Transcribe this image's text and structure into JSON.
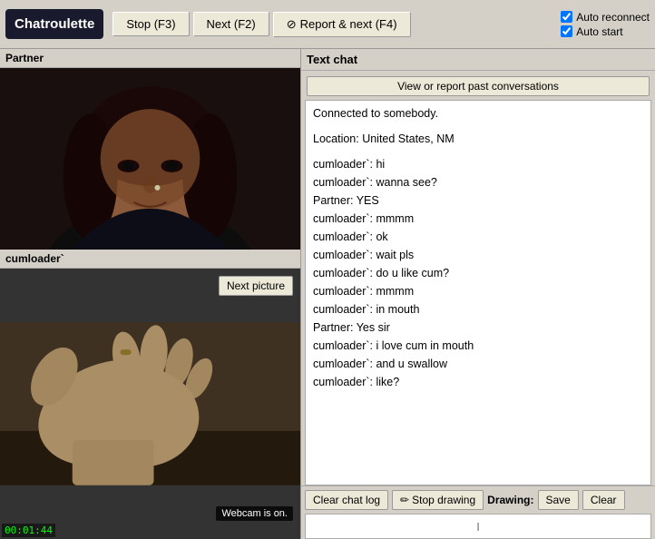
{
  "toolbar": {
    "logo": "Chatroulette",
    "stop_btn": "Stop (F3)",
    "next_btn": "Next (F2)",
    "report_btn": "Report & next (F4)",
    "auto_reconnect_label": "Auto reconnect",
    "auto_start_label": "Auto start",
    "auto_reconnect_checked": true,
    "auto_start_checked": true
  },
  "left_panel": {
    "partner_label": "Partner",
    "self_label": "cumloader`",
    "next_picture_btn": "Next picture",
    "webcam_badge": "Webcam is on.",
    "timer": "00:01:44"
  },
  "right_panel": {
    "header": "Text chat",
    "view_report_btn": "View or report past conversations",
    "messages": [
      {
        "text": "Connected to somebody.",
        "type": "system"
      },
      {
        "text": "",
        "type": "blank"
      },
      {
        "text": "Location: United States, NM",
        "type": "system"
      },
      {
        "text": "",
        "type": "blank"
      },
      {
        "text": "cumloader`: hi",
        "type": "chat"
      },
      {
        "text": "cumloader`: wanna see?",
        "type": "chat"
      },
      {
        "text": "Partner: YES",
        "type": "chat"
      },
      {
        "text": "cumloader`: mmmm",
        "type": "chat"
      },
      {
        "text": "cumloader`: ok",
        "type": "chat"
      },
      {
        "text": "cumloader`: wait pls",
        "type": "chat"
      },
      {
        "text": "cumloader`: do u like cum?",
        "type": "chat"
      },
      {
        "text": "cumloader`: mmmm",
        "type": "chat"
      },
      {
        "text": "cumloader`: in mouth",
        "type": "chat"
      },
      {
        "text": "Partner: Yes sir",
        "type": "chat"
      },
      {
        "text": "cumloader`: i love cum in mouth",
        "type": "chat"
      },
      {
        "text": "cumloader`: and u swallow",
        "type": "chat"
      },
      {
        "text": "cumloader`: like?",
        "type": "chat"
      }
    ]
  },
  "bottom_bar": {
    "clear_chat_btn": "Clear chat log",
    "stop_drawing_btn": "Stop drawing",
    "drawing_label": "Drawing:",
    "save_btn": "Save",
    "clear_btn": "Clear"
  },
  "chat_input": {
    "placeholder": "I",
    "value": ""
  }
}
